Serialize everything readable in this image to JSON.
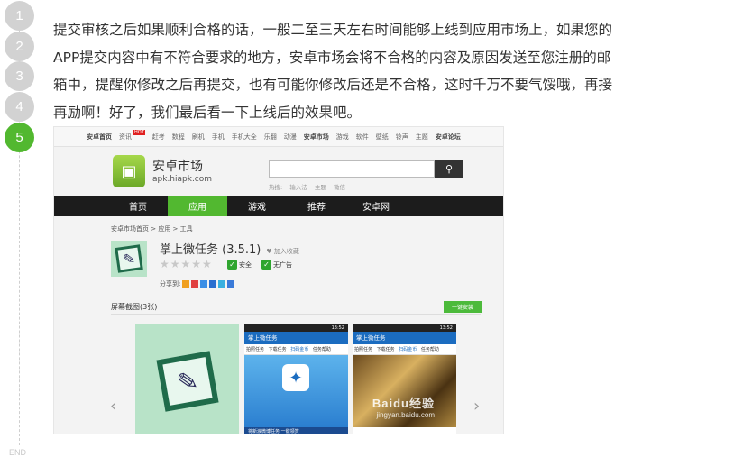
{
  "steps": [
    "1",
    "2",
    "3",
    "4",
    "5"
  ],
  "end_label": "END",
  "paragraph": "提交审核之后如果顺利合格的话，一般二至三天左右时间能够上线到应用市场上，如果您的APP提交内容中有不符合要求的地方，安卓市场会将不合格的内容及原因发送至您注册的邮箱中，提醒你修改之后再提交，也有可能你修改后还是不合格，这时千万不要气馁哦，再接再励啊！好了，我们最后看一下上线后的效果吧。",
  "shot": {
    "topnav": [
      "安卓首页",
      "资讯",
      "赶考",
      "数程",
      "刷机",
      "手机",
      "手机大全",
      "乐翻",
      "动漫",
      "安卓市场",
      "游戏",
      "软件",
      "壁纸",
      "铃声",
      "主题",
      "安卓论坛"
    ],
    "hot_tag": "HOT",
    "logo_title": "安卓市场",
    "logo_url": "apk.hiapk.com",
    "hot_search": [
      "热搜:",
      "输入法",
      "主题",
      "微信"
    ],
    "mainnav": [
      "首页",
      "应用",
      "游戏",
      "推荐",
      "安卓网"
    ],
    "breadcrumb": "安卓市场首页 > 应用 > 工具",
    "app_title": "掌上微任务 (3.5.1)",
    "fav_label": "加入收藏",
    "badge_safe": "安全",
    "badge_noad": "无广告",
    "share_label": "分享到:",
    "screens_label": "屏幕截图(3张)",
    "download_label": "一键安装",
    "phone": {
      "status_time": "13:52",
      "app_bar": "掌上微任务",
      "tabs": [
        "拍照任务",
        "下载任务",
        "扫码金币",
        "任务帮助"
      ],
      "footer": "将新浪微博任务  一键领赏"
    },
    "watermark_top": "Baidu经验",
    "watermark_bottom": "jingyan.baidu.com"
  }
}
